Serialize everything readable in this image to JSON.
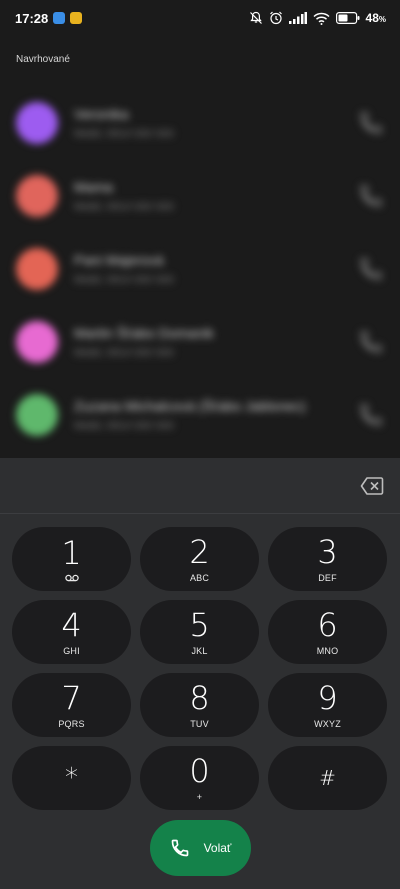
{
  "status_bar": {
    "time": "17:28",
    "battery_percent": "48",
    "app_badges": [
      {
        "name": "messenger-app-icon",
        "color": "#3a8ee6"
      },
      {
        "name": "notification-app-icon",
        "color": "#e8b21f"
      }
    ]
  },
  "suggested": {
    "title": "Navrhované",
    "contacts": [
      {
        "name": "Veronika",
        "sub": "Mobil, 0914 000 000",
        "avatar_color": "#9d5cf0"
      },
      {
        "name": "Mama",
        "sub": "Mobil, 0914 000 000",
        "avatar_color": "#e0655c"
      },
      {
        "name": "Pani Majerová",
        "sub": "Mobil, 0914 000 000",
        "avatar_color": "#e36555"
      },
      {
        "name": "Martin Šťabo Domanik",
        "sub": "Mobil, 0914 000 000",
        "avatar_color": "#e76ad1"
      },
      {
        "name": "Zuzana Michalcová (Šťabo Jablonec)",
        "sub": "Mobil, 0914 000 000",
        "avatar_color": "#5fb86c"
      }
    ]
  },
  "dialer": {
    "keys": [
      {
        "digit": "1",
        "letters": "",
        "voicemail": true
      },
      {
        "digit": "2",
        "letters": "ABC"
      },
      {
        "digit": "3",
        "letters": "DEF"
      },
      {
        "digit": "4",
        "letters": "GHI"
      },
      {
        "digit": "5",
        "letters": "JKL"
      },
      {
        "digit": "6",
        "letters": "MNO"
      },
      {
        "digit": "7",
        "letters": "PQRS"
      },
      {
        "digit": "8",
        "letters": "TUV"
      },
      {
        "digit": "9",
        "letters": "WXYZ"
      },
      {
        "digit": "*",
        "letters": ""
      },
      {
        "digit": "0",
        "letters": "+"
      },
      {
        "digit": "#",
        "letters": ""
      }
    ],
    "call_label": "Volať",
    "call_color": "#14824a"
  }
}
